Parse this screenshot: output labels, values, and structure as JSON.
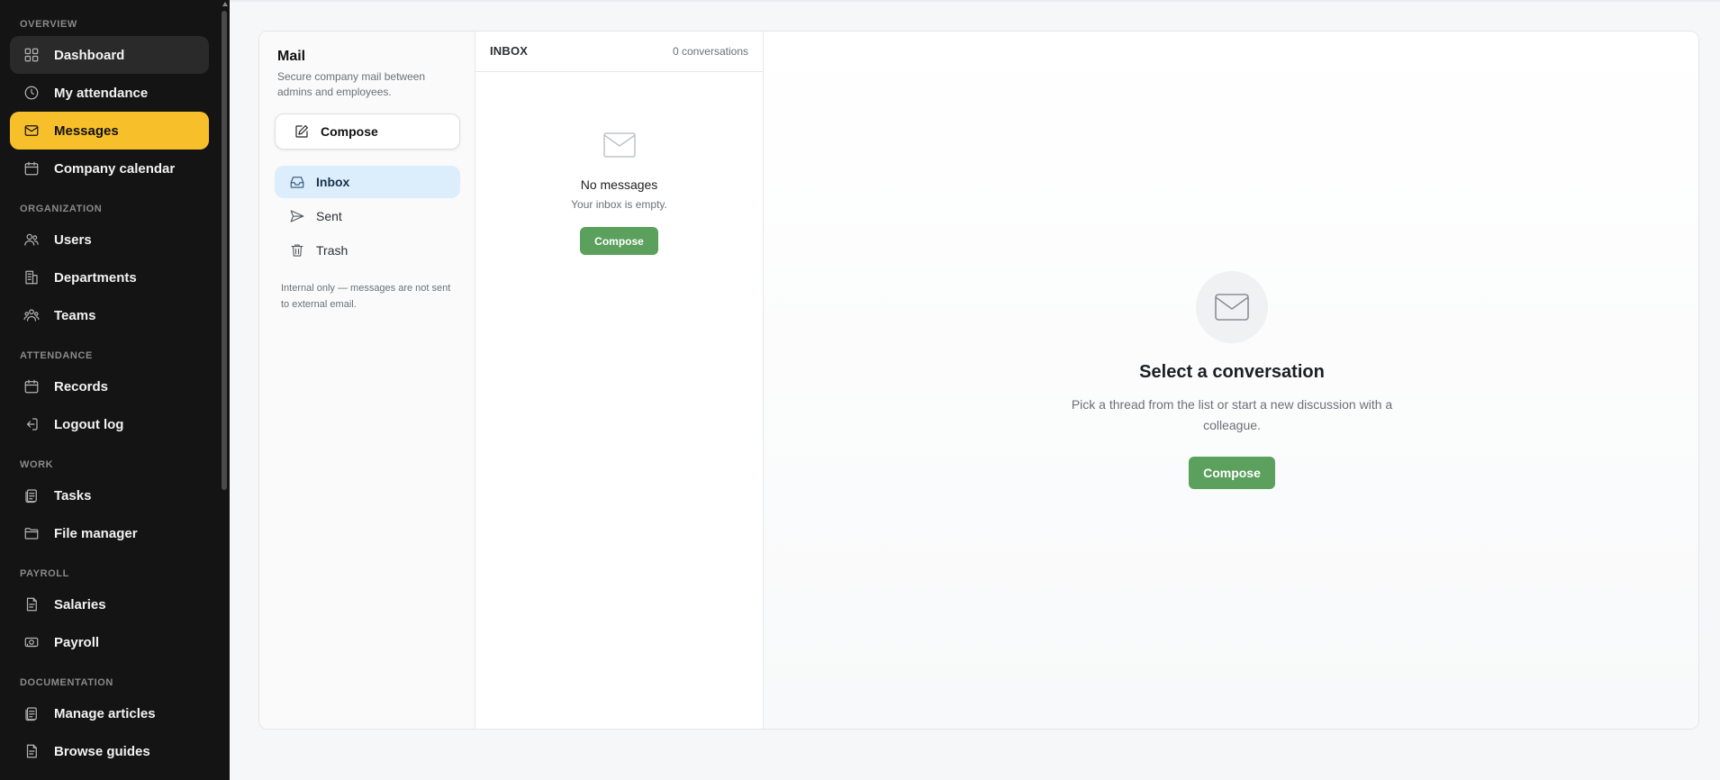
{
  "sidebar": {
    "sections": [
      {
        "title": "OVERVIEW"
      },
      {
        "title": "ORGANIZATION"
      },
      {
        "title": "ATTENDANCE"
      },
      {
        "title": "WORK"
      },
      {
        "title": "PAYROLL"
      },
      {
        "title": "DOCUMENTATION"
      }
    ],
    "items": [
      {
        "label": "Dashboard",
        "icon": "grid-icon"
      },
      {
        "label": "My attendance",
        "icon": "clock-icon"
      },
      {
        "label": "Messages",
        "icon": "mail-icon"
      },
      {
        "label": "Company calendar",
        "icon": "calendar-icon"
      },
      {
        "label": "Users",
        "icon": "users-icon"
      },
      {
        "label": "Departments",
        "icon": "building-icon"
      },
      {
        "label": "Teams",
        "icon": "team-icon"
      },
      {
        "label": "Records",
        "icon": "calendar-icon"
      },
      {
        "label": "Logout log",
        "icon": "logout-icon"
      },
      {
        "label": "Tasks",
        "icon": "clipboard-icon"
      },
      {
        "label": "File manager",
        "icon": "folder-icon"
      },
      {
        "label": "Salaries",
        "icon": "document-icon"
      },
      {
        "label": "Payroll",
        "icon": "banknote-icon"
      },
      {
        "label": "Manage articles",
        "icon": "clipboard-icon"
      },
      {
        "label": "Browse guides",
        "icon": "document-icon"
      }
    ],
    "active_item": "Messages",
    "accent_color": "#f7bf2a"
  },
  "mail": {
    "title": "Mail",
    "subtitle": "Secure company mail between admins and employees.",
    "compose_label": "Compose",
    "folders": [
      {
        "label": "Inbox",
        "icon": "inbox-icon"
      },
      {
        "label": "Sent",
        "icon": "send-icon"
      },
      {
        "label": "Trash",
        "icon": "trash-icon"
      }
    ],
    "active_folder": "Inbox",
    "note": "Internal only — messages are not sent to external email."
  },
  "list": {
    "title": "INBOX",
    "count": "0 conversations",
    "empty_title": "No messages",
    "empty_subtitle": "Your inbox is empty.",
    "compose_label": "Compose"
  },
  "reader": {
    "title": "Select a conversation",
    "subtitle": "Pick a thread from the list or start a new discussion with a colleague.",
    "compose_label": "Compose"
  },
  "colors": {
    "sidebar_bg": "#141414",
    "primary_green": "#5ba05c",
    "active_folder_bg": "#dcedfb"
  }
}
